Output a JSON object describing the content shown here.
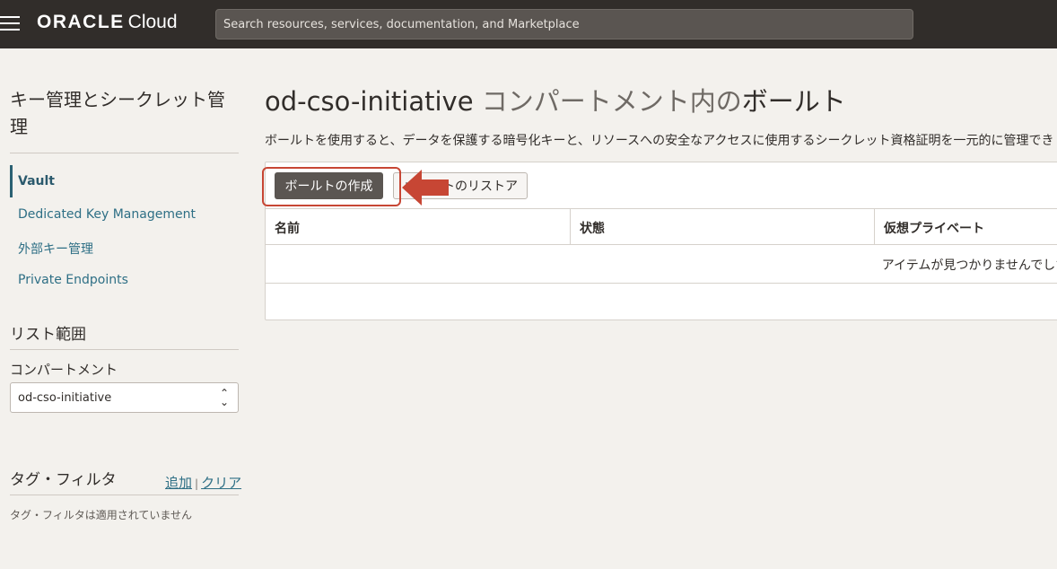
{
  "header": {
    "brand": "ORACLE",
    "product": "Cloud",
    "search_placeholder": "Search resources, services, documentation, and Marketplace"
  },
  "sidebar": {
    "title": "キー管理とシークレット管理",
    "nav": [
      {
        "label": "Vault",
        "active": true
      },
      {
        "label": "Dedicated Key Management",
        "active": false
      },
      {
        "label": "外部キー管理",
        "active": false
      },
      {
        "label": "Private Endpoints",
        "active": false
      }
    ],
    "scope_title": "リスト範囲",
    "compartment_label": "コンパートメント",
    "compartment_value": "od-cso-initiative",
    "tag_filter_title": "タグ・フィルタ",
    "tag_add": "追加",
    "tag_clear": "クリア",
    "tag_empty": "タグ・フィルタは適用されていません"
  },
  "main": {
    "title_compartment": "od-cso-initiative",
    "title_middle": " コンパートメント内の",
    "title_end": "ボールト",
    "description": "ボールトを使用すると、データを保護する暗号化キーと、リソースへの安全なアクセスに使用するシークレット資格証明を一元的に管理でき",
    "create_button": "ボールトの作成",
    "restore_button": "ボールトのリストア",
    "columns": [
      "名前",
      "状態",
      "仮想プライベート"
    ],
    "empty_message": "アイテムが見つかりませんでした。"
  },
  "colors": {
    "topbar": "#312d2a",
    "link": "#2e6f85",
    "highlight": "#c74634"
  },
  "icons": {
    "menu": "hamburger-icon",
    "select": "chevron-updown-icon",
    "annotation": "red-arrow-icon"
  }
}
